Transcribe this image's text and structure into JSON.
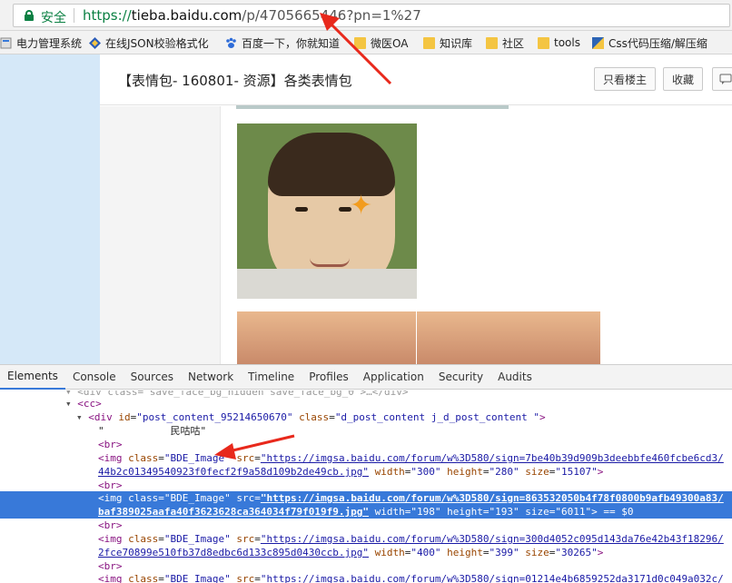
{
  "browser": {
    "secure_label": "安全",
    "url_scheme": "https://",
    "url_host": "tieba.baidu.com",
    "url_path": "/p/4705665446?pn=1%27"
  },
  "bookmarks": [
    {
      "label": "电力管理系统",
      "icon": "page-icon"
    },
    {
      "label": "在线JSON校验格式化",
      "icon": "diamond-icon"
    },
    {
      "label": "百度一下，你就知道",
      "icon": "paw-icon"
    },
    {
      "label": "微医OA",
      "icon": "folder-icon"
    },
    {
      "label": "知识库",
      "icon": "folder-icon"
    },
    {
      "label": "社区",
      "icon": "folder-icon"
    },
    {
      "label": "tools",
      "icon": "folder-icon"
    },
    {
      "label": "Css代码压缩/解压缩",
      "icon": "css-icon"
    }
  ],
  "page": {
    "title": "【表情包- 160801- 资源】各类表情包",
    "btn_only_op": "只看楼主",
    "btn_favorite": "收藏"
  },
  "devtools": {
    "tabs": [
      "Elements",
      "Console",
      "Sources",
      "Network",
      "Timeline",
      "Profiles",
      "Application",
      "Security",
      "Audits"
    ],
    "active_tab": "Elements",
    "lines": {
      "l0": "▾ <div class=\"save_face_bg_hidden save_face_bg_0\">…</div>",
      "l1_tag": "<cc>",
      "l2_open": "<div ",
      "l2_attr1": "id",
      "l2_val1": "\"post_content_95214650670\"",
      "l2_attr2": "class",
      "l2_val2": "\"d_post_content j_d_post_content \"",
      "l2_close": ">",
      "l3_text": "\"           民咕咕\"",
      "br": "<br>",
      "img1_tag": "<img ",
      "img1_class": "class",
      "img1_class_val": "\"BDE_Image\"",
      "img1_src": "src",
      "img1_src_val_a": "\"https://imgsa.baidu.com/forum/w%3D580/sign=7be40b39d909b3deebbfe460fcbe6cd3/",
      "img1_src_val_b": "44b2c01349540923f0fecf2f9a58d109b2de49cb.jpg\"",
      "img1_width": "width",
      "img1_width_val": "\"300\"",
      "img1_height": "height",
      "img1_height_val": "\"280\"",
      "img1_size": "size",
      "img1_size_val": "\"15107\"",
      "img1_end": ">",
      "img2_tag": "<img ",
      "img2_class": "class",
      "img2_class_val": "\"BDE_Image\"",
      "img2_src": "src",
      "img2_src_val_a": "\"https://imgsa.baidu.com/forum/w%3D580/sign=863532050b4f78f0800b9afb49300a83/",
      "img2_src_val_b": "baf389025aafa40f3623628ca364034f79f019f9.jpg\"",
      "img2_width": "width",
      "img2_width_val": "\"198\"",
      "img2_height": "height",
      "img2_height_val": "\"193\"",
      "img2_size": "size",
      "img2_size_val": "\"6011\"",
      "img2_end": "> == $0",
      "img3_tag": "<img ",
      "img3_class": "class",
      "img3_class_val": "\"BDE_Image\"",
      "img3_src": "src",
      "img3_src_val_a": "\"https://imgsa.baidu.com/forum/w%3D580/sign=300d4052c095d143da76e42b43f18296/",
      "img3_src_val_b": "2fce70899e510fb37d8edbc6d133c895d0430ccb.jpg\"",
      "img3_width": "width",
      "img3_width_val": "\"400\"",
      "img3_height": "height",
      "img3_height_val": "\"399\"",
      "img3_size": "size",
      "img3_size_val": "\"30265\"",
      "img3_end": ">",
      "img4_tag": "<img ",
      "img4_class": "class",
      "img4_class_val": "\"BDE_Image\"",
      "img4_src": "src",
      "img4_src_val_a": "\"https://imgsa.baidu.com/forum/w%3D580/sign=01214e4b6859252da3171d0c049a032c/"
    }
  },
  "colors": {
    "selection": "#3879d9",
    "annotation_arrow": "#e8291c",
    "secure_green": "#0b8043"
  }
}
